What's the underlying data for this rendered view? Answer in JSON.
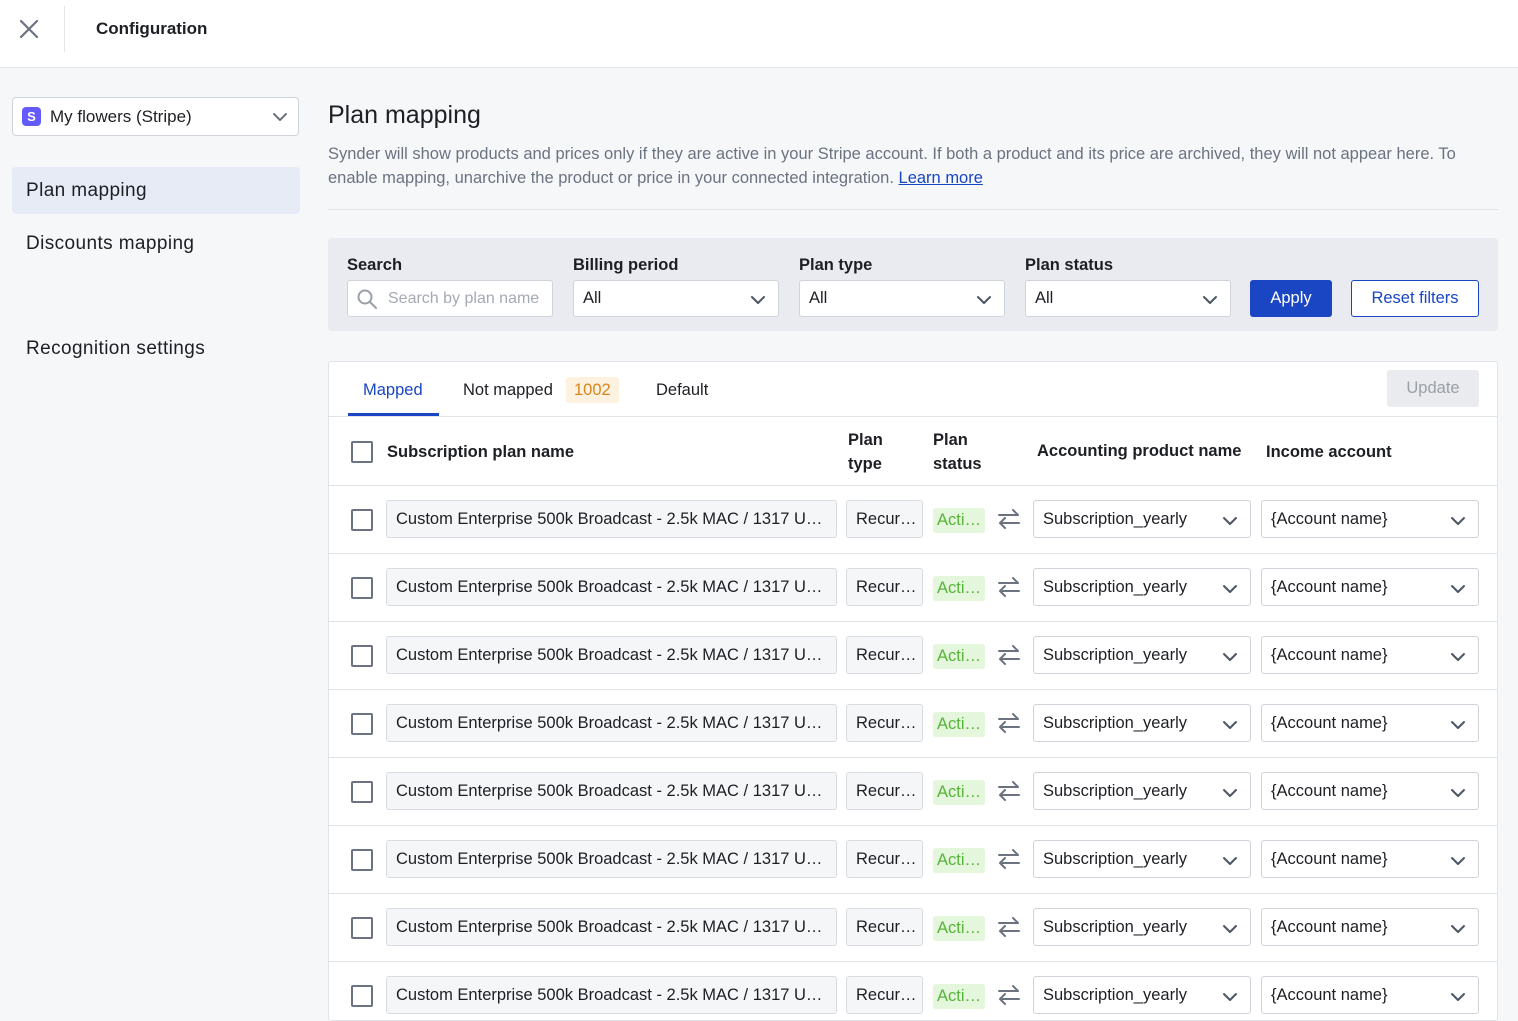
{
  "header": {
    "title": "Configuration",
    "close_icon": "close-icon"
  },
  "sidebar": {
    "integration": {
      "badge": "S",
      "label": "My flowers (Stripe)"
    },
    "items": [
      {
        "label": "Plan mapping",
        "active": true
      },
      {
        "label": "Discounts mapping",
        "active": false
      },
      {
        "label": "Recognition settings",
        "active": false
      }
    ]
  },
  "page": {
    "title": "Plan mapping",
    "description": "Synder will show products and prices only if they are active in your Stripe account. If both a product and its price are archived, they will not appear here. To enable mapping, unarchive the product or price in your connected integration. ",
    "learn_more": "Learn more"
  },
  "filters": {
    "search_label": "Search",
    "search_placeholder": "Search by plan name",
    "billing_label": "Billing period",
    "billing_value": "All",
    "plan_type_label": "Plan type",
    "plan_type_value": "All",
    "plan_status_label": "Plan status",
    "plan_status_value": "All",
    "apply": "Apply",
    "reset": "Reset filters"
  },
  "tabs": {
    "mapped": "Mapped",
    "not_mapped": "Not mapped",
    "not_mapped_count": "1002",
    "default": "Default",
    "update": "Update"
  },
  "table": {
    "columns": {
      "name": "Subscription plan name",
      "plan_type_1": "Plan",
      "plan_type_2": "type",
      "plan_status_1": "Plan",
      "plan_status_2": "status",
      "product": "Accounting product name",
      "income": "Income account"
    },
    "rows": [
      {
        "name": "Custom Enterprise 500k Broadcast - 2.5k MAC / 1317 U…",
        "type": "Recur…",
        "status": "Acti…",
        "product": "Subscription_yearly",
        "income": "{Account name}"
      },
      {
        "name": "Custom Enterprise 500k Broadcast - 2.5k MAC / 1317 U…",
        "type": "Recur…",
        "status": "Acti…",
        "product": "Subscription_yearly",
        "income": "{Account name}"
      },
      {
        "name": "Custom Enterprise 500k Broadcast - 2.5k MAC / 1317 U…",
        "type": "Recur…",
        "status": "Acti…",
        "product": "Subscription_yearly",
        "income": "{Account name}"
      },
      {
        "name": "Custom Enterprise 500k Broadcast - 2.5k MAC / 1317 U…",
        "type": "Recur…",
        "status": "Acti…",
        "product": "Subscription_yearly",
        "income": "{Account name}"
      },
      {
        "name": "Custom Enterprise 500k Broadcast - 2.5k MAC / 1317 U…",
        "type": "Recur…",
        "status": "Acti…",
        "product": "Subscription_yearly",
        "income": "{Account name}"
      },
      {
        "name": "Custom Enterprise 500k Broadcast - 2.5k MAC / 1317 U…",
        "type": "Recur…",
        "status": "Acti…",
        "product": "Subscription_yearly",
        "income": "{Account name}"
      },
      {
        "name": "Custom Enterprise 500k Broadcast - 2.5k MAC / 1317 U…",
        "type": "Recur…",
        "status": "Acti…",
        "product": "Subscription_yearly",
        "income": "{Account name}"
      },
      {
        "name": "Custom Enterprise 500k Broadcast - 2.5k MAC / 1317 U…",
        "type": "Recur…",
        "status": "Acti…",
        "product": "Subscription_yearly",
        "income": "{Account name}"
      }
    ]
  },
  "colors": {
    "primary": "#1a46c4",
    "active_nav": "#e6ebf5",
    "status_green": "#58b33b",
    "badge_orange": "#d9851c",
    "stripe": "#635bff"
  }
}
